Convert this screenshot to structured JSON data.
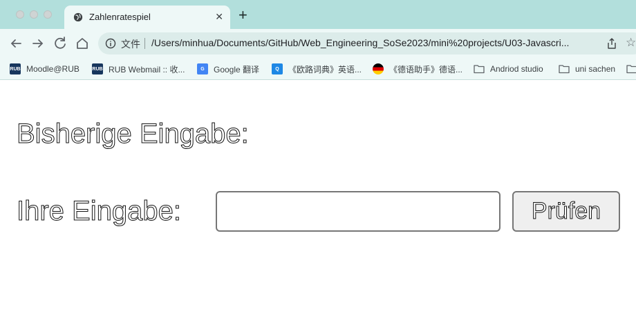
{
  "browser": {
    "tab": {
      "title": "Zahlenratespiel",
      "favicon": "globe-icon",
      "close": "✕"
    },
    "new_tab": "+",
    "omnibox": {
      "scheme_label": "文件",
      "url": "/Users/minhua/Documents/GitHub/Web_Engineering_SoSe2023/mini%20projects/U03-Javascri..."
    },
    "bookmarks": [
      {
        "label": "Moodle@RUB",
        "icon": "rub-icon",
        "badge": "RUB",
        "color": "#17365d"
      },
      {
        "label": "RUB Webmail :: 收...",
        "icon": "rub-icon",
        "badge": "RUB",
        "color": "#17365d"
      },
      {
        "label": "Google 翻译",
        "icon": "google-translate-icon",
        "badge": "G",
        "color": "#4285f4"
      },
      {
        "label": "《欧路词典》英语...",
        "icon": "eudic-icon",
        "badge": "Q",
        "color": "#1e88e5"
      },
      {
        "label": "《德语助手》德语...",
        "icon": "german-flag-icon",
        "badge": "",
        "color": "#000000"
      },
      {
        "label": "Andriod studio",
        "icon": "folder-icon",
        "badge": "",
        "color": "#5f6368"
      },
      {
        "label": "uni sachen",
        "icon": "folder-icon",
        "badge": "",
        "color": "#5f6368"
      }
    ]
  },
  "page": {
    "heading": "Bisherige Eingabe:",
    "input_label": "Ihre Eingabe:",
    "input_value": "",
    "button_label": "Prüfen"
  }
}
